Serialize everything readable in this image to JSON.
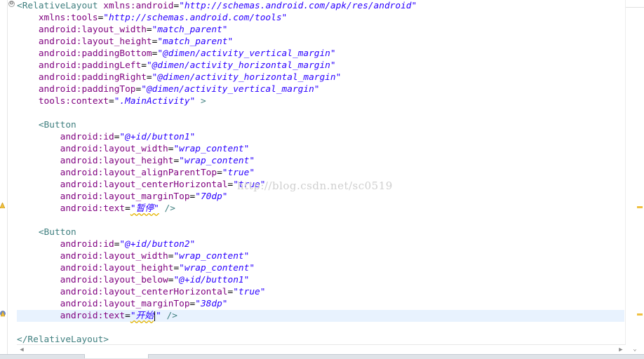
{
  "editor": {
    "lines": {
      "l1": {
        "tag": "<RelativeLayout",
        "attr": "xmlns:android",
        "val": "\"http://schemas.android.com/apk/res/android\""
      },
      "l2": {
        "attr": "xmlns:tools",
        "val": "\"http://schemas.android.com/tools\""
      },
      "l3": {
        "attr": "android:layout_width",
        "val": "\"match_parent\""
      },
      "l4": {
        "attr": "android:layout_height",
        "val": "\"match_parent\""
      },
      "l5": {
        "attr": "android:paddingBottom",
        "val": "\"@dimen/activity_vertical_margin\""
      },
      "l6": {
        "attr": "android:paddingLeft",
        "val": "\"@dimen/activity_horizontal_margin\""
      },
      "l7": {
        "attr": "android:paddingRight",
        "val": "\"@dimen/activity_horizontal_margin\""
      },
      "l8": {
        "attr": "android:paddingTop",
        "val": "\"@dimen/activity_vertical_margin\""
      },
      "l9": {
        "attr": "tools:context",
        "val": "\".MainActivity\"",
        "close": " >"
      },
      "l11": {
        "tag": "<Button"
      },
      "l12": {
        "attr": "android:id",
        "val": "\"@+id/button1\""
      },
      "l13": {
        "attr": "android:layout_width",
        "val": "\"wrap_content\""
      },
      "l14": {
        "attr": "android:layout_height",
        "val": "\"wrap_content\""
      },
      "l15": {
        "attr": "android:layout_alignParentTop",
        "val": "\"true\""
      },
      "l16": {
        "attr": "android:layout_centerHorizontal",
        "val": "\"true\""
      },
      "l17": {
        "attr": "android:layout_marginTop",
        "val": "\"70dp\""
      },
      "l18": {
        "attr": "android:text",
        "val": "\"暂停\"",
        "close": " />"
      },
      "l20": {
        "tag": "<Button"
      },
      "l21": {
        "attr": "android:id",
        "val": "\"@+id/button2\""
      },
      "l22": {
        "attr": "android:layout_width",
        "val": "\"wrap_content\""
      },
      "l23": {
        "attr": "android:layout_height",
        "val": "\"wrap_content\""
      },
      "l24": {
        "attr": "android:layout_below",
        "val": "\"@+id/button1\""
      },
      "l25": {
        "attr": "android:layout_centerHorizontal",
        "val": "\"true\""
      },
      "l26": {
        "attr": "android:layout_marginTop",
        "val": "\"38dp\""
      },
      "l27": {
        "attr": "android:text",
        "val_a": "\"开始",
        "val_b": "\"",
        "close": " />"
      },
      "l29": {
        "tag": "</RelativeLayout>"
      }
    },
    "eq": "="
  },
  "watermark": "http://blog.csdn.net/sc0519",
  "glyphs": {
    "fold": "⊖",
    "left_arrow": "◀",
    "right_arrow": "▶",
    "down_arrow": "⌄"
  },
  "colors": {
    "tag": "#3f7f7f",
    "attribute": "#7f007f",
    "value": "#2a00ff",
    "current_line": "#e8f2fe",
    "warning": "#f0c040"
  }
}
